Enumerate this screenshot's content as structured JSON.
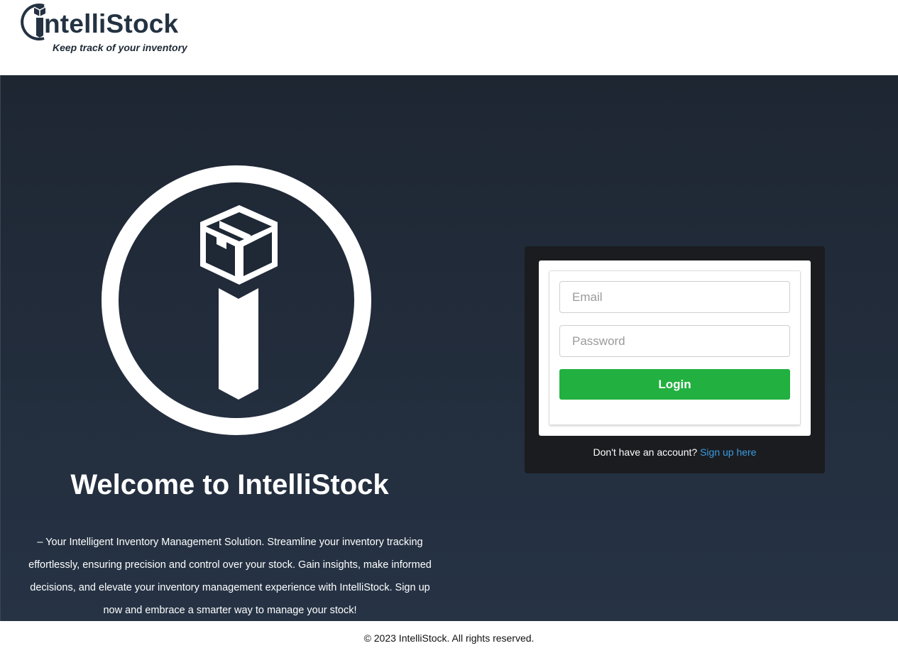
{
  "brand": {
    "name": "IntelliStock",
    "name_prefix": "i",
    "name_rest": "ntelliStock",
    "tagline": "Keep track of your inventory",
    "logo_icon": "box-on-i-icon"
  },
  "hero": {
    "emblem_icon": "intellistock-emblem-icon",
    "title": "Welcome to IntelliStock",
    "intro": "– Your Intelligent Inventory Management Solution. Streamline your inventory tracking effortlessly, ensuring precision and control over your stock. Gain insights, make informed decisions, and elevate your inventory management experience with IntelliStock. Sign up now and embrace a smarter way to manage your stock!"
  },
  "login": {
    "email_placeholder": "Email",
    "email_value": "",
    "password_placeholder": "Password",
    "password_value": "",
    "submit_label": "Login",
    "signup_prompt": "Don't have an account?",
    "signup_link": "Sign up here"
  },
  "footer": {
    "copyright": "© 2023 IntelliStock. All rights reserved."
  },
  "colors": {
    "hero_top": "#1e2632",
    "hero_bottom": "#263345",
    "card_bg": "#1b1c20",
    "accent_green": "#22b040",
    "link_blue": "#3a9be0",
    "brand_navy": "#243242"
  }
}
